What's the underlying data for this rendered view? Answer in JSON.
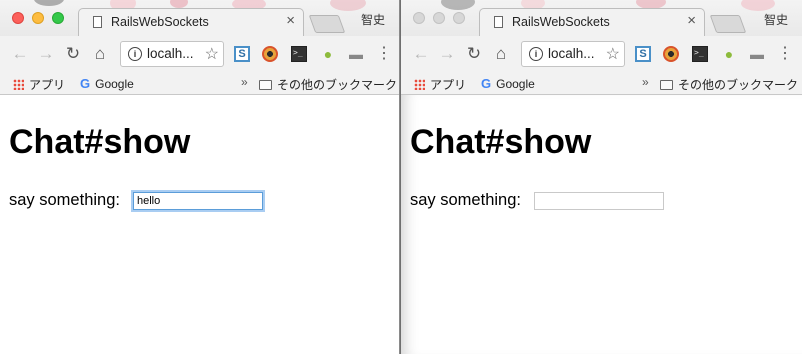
{
  "windows": [
    {
      "tab": {
        "title": "RailsWebSockets",
        "close": "×"
      },
      "profile": "智史",
      "toolbar": {
        "back": "←",
        "forward": "→",
        "reload": "↻",
        "home": "⌂",
        "url": "localh...",
        "info": "i",
        "star": "☆",
        "menu": "⋮"
      },
      "extensions": [
        "S",
        "eye-ext-icon",
        ">_",
        "android-ext-icon",
        "mask-ext-icon"
      ],
      "bookmarks": {
        "apps": "アプリ",
        "google": "Google",
        "more": "»",
        "other": "その他のブックマーク"
      },
      "page": {
        "heading": "Chat#show",
        "prompt": "say something:",
        "input_value": "hello"
      }
    },
    {
      "tab": {
        "title": "RailsWebSockets",
        "close": "×"
      },
      "profile": "智史",
      "toolbar": {
        "back": "←",
        "forward": "→",
        "reload": "↻",
        "home": "⌂",
        "url": "localh...",
        "info": "i",
        "star": "☆",
        "menu": "⋮"
      },
      "extensions": [
        "S",
        "eye-ext-icon",
        ">_",
        "android-ext-icon",
        "mask-ext-icon"
      ],
      "bookmarks": {
        "apps": "アプリ",
        "google": "Google",
        "more": "»",
        "other": "その他のブックマーク"
      },
      "page": {
        "heading": "Chat#show",
        "prompt": "say something:",
        "input_value": ""
      }
    }
  ],
  "colors": {
    "focus_ring": "#5b9dd9",
    "close_red": "#fc605b",
    "minimize_yellow": "#fdbc40",
    "zoom_green": "#34c84a"
  }
}
